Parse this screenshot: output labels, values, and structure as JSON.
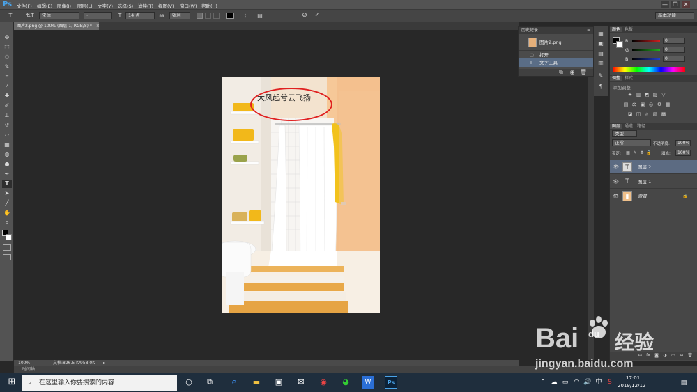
{
  "app": {
    "logo": "Ps"
  },
  "menu": [
    "文件(F)",
    "编辑(E)",
    "图像(I)",
    "图层(L)",
    "文字(Y)",
    "选择(S)",
    "滤镜(T)",
    "视图(V)",
    "窗口(W)",
    "帮助(H)"
  ],
  "window_buttons": {
    "minimize": "—",
    "restore": "❐",
    "close": "✕"
  },
  "options_bar": {
    "tool_glyph": "T",
    "orient_glyph": "⇅T",
    "font_family": "宋体",
    "font_style": "-",
    "size_glyph": "T",
    "font_size": "14 点",
    "aa_glyph": "aa",
    "antialias": "锐利",
    "warp_glyph": "⌇",
    "panel_glyph": "▤",
    "cancel_glyph": "⊘",
    "commit_glyph": "✓",
    "workspace": "基本功能"
  },
  "document_tab": {
    "title": "图片2.png @ 100% (图层 1, RGB/8) *",
    "close": "×"
  },
  "canvas": {
    "text_layer": "大风起兮云飞扬",
    "annotation_color": "#e02020"
  },
  "status": {
    "zoom": "100%",
    "doc_info": "文档:826.5 K/958.0K",
    "arrow": "▸"
  },
  "timeline": {
    "label": "时间轴"
  },
  "tools": [
    {
      "name": "move-tool-icon",
      "glyph": "✥"
    },
    {
      "name": "marquee-tool-icon",
      "glyph": "⬚"
    },
    {
      "name": "lasso-tool-icon",
      "glyph": "◌"
    },
    {
      "name": "quick-select-tool-icon",
      "glyph": "✎"
    },
    {
      "name": "crop-tool-icon",
      "glyph": "⌗"
    },
    {
      "name": "eyedropper-tool-icon",
      "glyph": "⁄"
    },
    {
      "name": "healing-tool-icon",
      "glyph": "✚"
    },
    {
      "name": "brush-tool-icon",
      "glyph": "✐"
    },
    {
      "name": "stamp-tool-icon",
      "glyph": "⊥"
    },
    {
      "name": "history-brush-tool-icon",
      "glyph": "↺"
    },
    {
      "name": "eraser-tool-icon",
      "glyph": "▱"
    },
    {
      "name": "gradient-tool-icon",
      "glyph": "▦"
    },
    {
      "name": "blur-tool-icon",
      "glyph": "◍"
    },
    {
      "name": "dodge-tool-icon",
      "glyph": "●"
    },
    {
      "name": "pen-tool-icon",
      "glyph": "✒"
    },
    {
      "name": "type-tool-icon",
      "glyph": "T"
    },
    {
      "name": "path-select-tool-icon",
      "glyph": "➤"
    },
    {
      "name": "line-tool-icon",
      "glyph": "╱"
    },
    {
      "name": "hand-tool-icon",
      "glyph": "✋"
    },
    {
      "name": "zoom-tool-icon",
      "glyph": "⌕"
    }
  ],
  "history_panel": {
    "tab": "历史记录",
    "menu_glyph": "≡",
    "snapshot": "图片2.png",
    "items": [
      {
        "glyph": "▢",
        "label": "打开"
      },
      {
        "glyph": "T",
        "label": "文字工具"
      }
    ],
    "footer_icons": [
      "⧉",
      "◉",
      "🗑"
    ]
  },
  "side_icons": [
    "▦",
    "▣",
    "▤",
    "▥",
    "✎",
    "¶"
  ],
  "color_panel": {
    "tabs": [
      "颜色",
      "色板"
    ],
    "channels": [
      {
        "label": "R",
        "value": "0",
        "color": "#d02020"
      },
      {
        "label": "G",
        "value": "0",
        "color": "#20b020"
      },
      {
        "label": "B",
        "value": "0",
        "color": "#2040d0"
      }
    ]
  },
  "adjust_panel": {
    "tabs": [
      "调整",
      "样式"
    ],
    "hint": "添加调整",
    "row1": [
      "☀",
      "▥",
      "◩",
      "▨",
      "▽"
    ],
    "row2": [
      "▤",
      "⚖",
      "▣",
      "◎",
      "⚙",
      "▦"
    ],
    "row3": [
      "◪",
      "◫",
      "◬",
      "▧",
      "▩"
    ]
  },
  "layers_panel": {
    "tabs": [
      "图层",
      "通道",
      "路径"
    ],
    "kind": "类型",
    "blend": "正常",
    "opacity_label": "不透明度:",
    "opacity": "100%",
    "lock_label": "锁定:",
    "fill_label": "填充:",
    "fill": "100%",
    "lock_icons": [
      "▦",
      "✎",
      "✥",
      "🔒"
    ],
    "layers": [
      {
        "name": "图层 2",
        "thumb": "T",
        "selected": true
      },
      {
        "name": "图层 1",
        "thumb": "T",
        "selected": false
      },
      {
        "name": "背景",
        "thumb": "▮",
        "selected": false,
        "locked": "🔒"
      }
    ],
    "footer_icons": [
      "⊶",
      "fx",
      "◙",
      "◑",
      "▭",
      "⊞",
      "🗑"
    ]
  },
  "taskbar": {
    "start_glyph": "⊞",
    "search_glyph": "⌕",
    "search_placeholder": "在这里输入你要搜索的内容",
    "apps": [
      {
        "name": "cortana-icon",
        "glyph": "○"
      },
      {
        "name": "task-view-icon",
        "glyph": "⧉"
      },
      {
        "name": "edge-icon",
        "glyph": "e"
      },
      {
        "name": "file-explorer-icon",
        "glyph": "▬"
      },
      {
        "name": "store-icon",
        "glyph": "▣"
      },
      {
        "name": "mail-icon",
        "glyph": "✉"
      },
      {
        "name": "chrome-icon",
        "glyph": "◉"
      },
      {
        "name": "wechat-icon",
        "glyph": "◕"
      },
      {
        "name": "app-w-icon",
        "glyph": "W"
      },
      {
        "name": "photoshop-icon",
        "glyph": "Ps"
      }
    ],
    "tray_icons": [
      "⌃",
      "☁",
      "▭",
      "◠",
      "🔊",
      "中",
      "S"
    ],
    "time": "17:01",
    "date": "2019/12/12",
    "notification_glyph": "▤"
  },
  "watermark": {
    "brand": "Bai",
    "logo_suffix": "du",
    "cn": "经验",
    "url": "jingyan.baidu.com"
  }
}
